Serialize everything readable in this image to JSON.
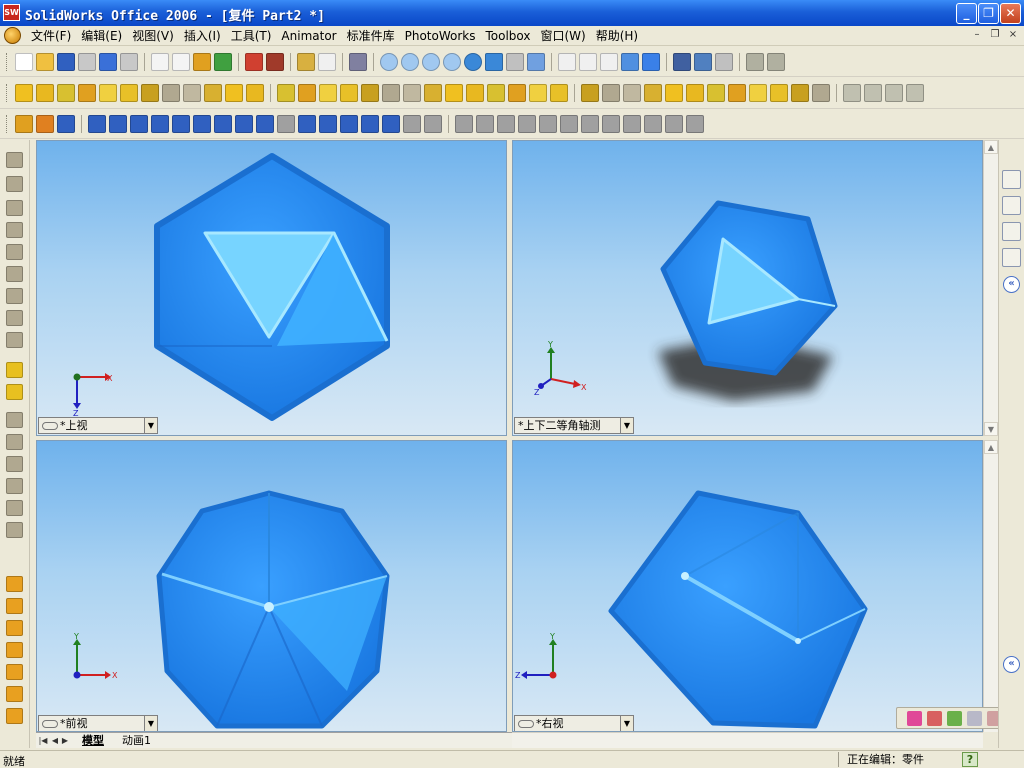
{
  "window": {
    "title": "SolidWorks Office 2006 - [复件 Part2 *]",
    "app_icon_text": "SW",
    "minimize": "_",
    "maximize": "❐",
    "close": "✕"
  },
  "menu": {
    "items": [
      {
        "label": "文件(F)"
      },
      {
        "label": "编辑(E)"
      },
      {
        "label": "视图(V)"
      },
      {
        "label": "插入(I)"
      },
      {
        "label": "工具(T)"
      },
      {
        "label": "Animator"
      },
      {
        "label": "标准件库"
      },
      {
        "label": "PhotoWorks"
      },
      {
        "label": "Toolbox"
      },
      {
        "label": "窗口(W)"
      },
      {
        "label": "帮助(H)"
      }
    ],
    "mdi_minimize": "–",
    "mdi_restore": "❐",
    "mdi_close": "×"
  },
  "viewports": {
    "top_left": {
      "label": "*上视",
      "triad_axes": [
        "X",
        "Z"
      ]
    },
    "top_right": {
      "label": "*上下二等角轴测",
      "triad_axes": [
        "Y",
        "X",
        "Z"
      ]
    },
    "bottom_left": {
      "label": "*前视",
      "triad_axes": [
        "Y",
        "X"
      ]
    },
    "bottom_right": {
      "label": "*右视",
      "triad_axes": [
        "Y",
        "Z"
      ]
    }
  },
  "colors": {
    "model_blue": "#2a8cf0",
    "model_highlight": "#7fdcff",
    "background_top": "#6fb2ec",
    "background_bottom": "#d8e8f4",
    "axis_x": "#d02020",
    "axis_y": "#208020",
    "axis_z": "#2020c0"
  },
  "tabs": {
    "model": "模型",
    "animation": "动画1"
  },
  "status": {
    "left": "就绪",
    "right": "正在编辑：零件",
    "help": "?"
  }
}
